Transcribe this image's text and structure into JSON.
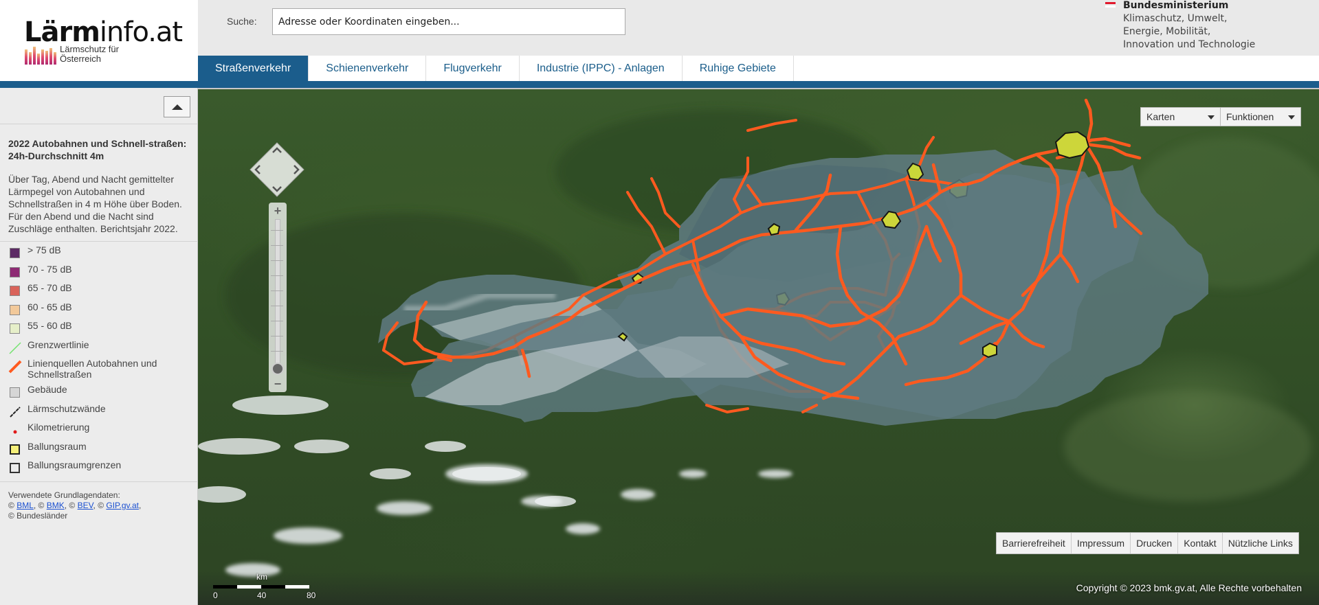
{
  "logo": {
    "name_part1": "Lärm",
    "name_part2": "info.at",
    "tagline_line1": "Lärmschutz für",
    "tagline_line2": "Österreich"
  },
  "search": {
    "label": "Suche:",
    "placeholder": "Adresse oder Koordinaten eingeben..."
  },
  "ministry": {
    "title": "Bundesministerium",
    "lines": [
      "Klimaschutz, Umwelt,",
      "Energie, Mobilität,",
      "Innovation und Technologie"
    ]
  },
  "tabs": [
    {
      "label": "Straßenverkehr",
      "active": true
    },
    {
      "label": "Schienenverkehr",
      "active": false
    },
    {
      "label": "Flugverkehr",
      "active": false
    },
    {
      "label": "Industrie (IPPC) - Anlagen",
      "active": false
    },
    {
      "label": "Ruhige Gebiete",
      "active": false
    }
  ],
  "layer": {
    "title": "2022 Autobahnen und Schnell-straßen: 24h-Durchschnitt 4m",
    "description": "Über Tag, Abend und Nacht gemittelter Lärmpegel von Autobahnen und Schnellstraßen in 4 m Höhe über Boden. Für den Abend und die Nacht sind Zuschläge enthalten. Berichtsjahr 2022."
  },
  "legend": [
    {
      "label": "> 75 dB",
      "type": "swatch",
      "color": "#5c2a64"
    },
    {
      "label": "70 - 75 dB",
      "type": "swatch",
      "color": "#8e2a74"
    },
    {
      "label": "65 - 70 dB",
      "type": "swatch",
      "color": "#d9635a"
    },
    {
      "label": "60 - 65 dB",
      "type": "swatch",
      "color": "#f2c99a"
    },
    {
      "label": "55 - 60 dB",
      "type": "swatch",
      "color": "#e6efc9"
    },
    {
      "label": "Grenzwertlinie",
      "type": "line",
      "color": "#74e36f"
    },
    {
      "label": "Linienquellen Autobahnen und Schnellstraßen",
      "type": "thickline",
      "color": "#ff5a1f"
    },
    {
      "label": "Gebäude",
      "type": "swatch",
      "color": "#d6d6d6"
    },
    {
      "label": "Lärmschutzwände",
      "type": "wall",
      "color": "#222222"
    },
    {
      "label": "Kilometrierung",
      "type": "dot",
      "color": "#e01a1a"
    },
    {
      "label": "Ballungsraum",
      "type": "swatch-thick",
      "color": "#f5f07a"
    },
    {
      "label": "Ballungsraumgrenzen",
      "type": "outline",
      "color": "#333333"
    }
  ],
  "sources": {
    "heading": "Verwendete Grundlagendaten:",
    "copy": "©",
    "links": [
      "BML",
      "BMK",
      "BEV",
      "GIP.gv.at"
    ],
    "last": "© Bundesländer"
  },
  "map_controls": {
    "maps_label": "Karten",
    "functions_label": "Funktionen"
  },
  "zoom": {
    "plus": "+",
    "minus": "−"
  },
  "scale": {
    "unit": "km",
    "ticks": [
      "0",
      "40",
      "80"
    ]
  },
  "footer_links": [
    "Barrierefreiheit",
    "Impressum",
    "Drucken",
    "Kontakt",
    "Nützliche Links"
  ],
  "copyright": "Copyright © 2023 bmk.gv.at, Alle Rechte vorbehalten",
  "colors": {
    "accent": "#1b5d8c",
    "road": "#ff5a1f",
    "agglomeration": "#c9d83a"
  }
}
